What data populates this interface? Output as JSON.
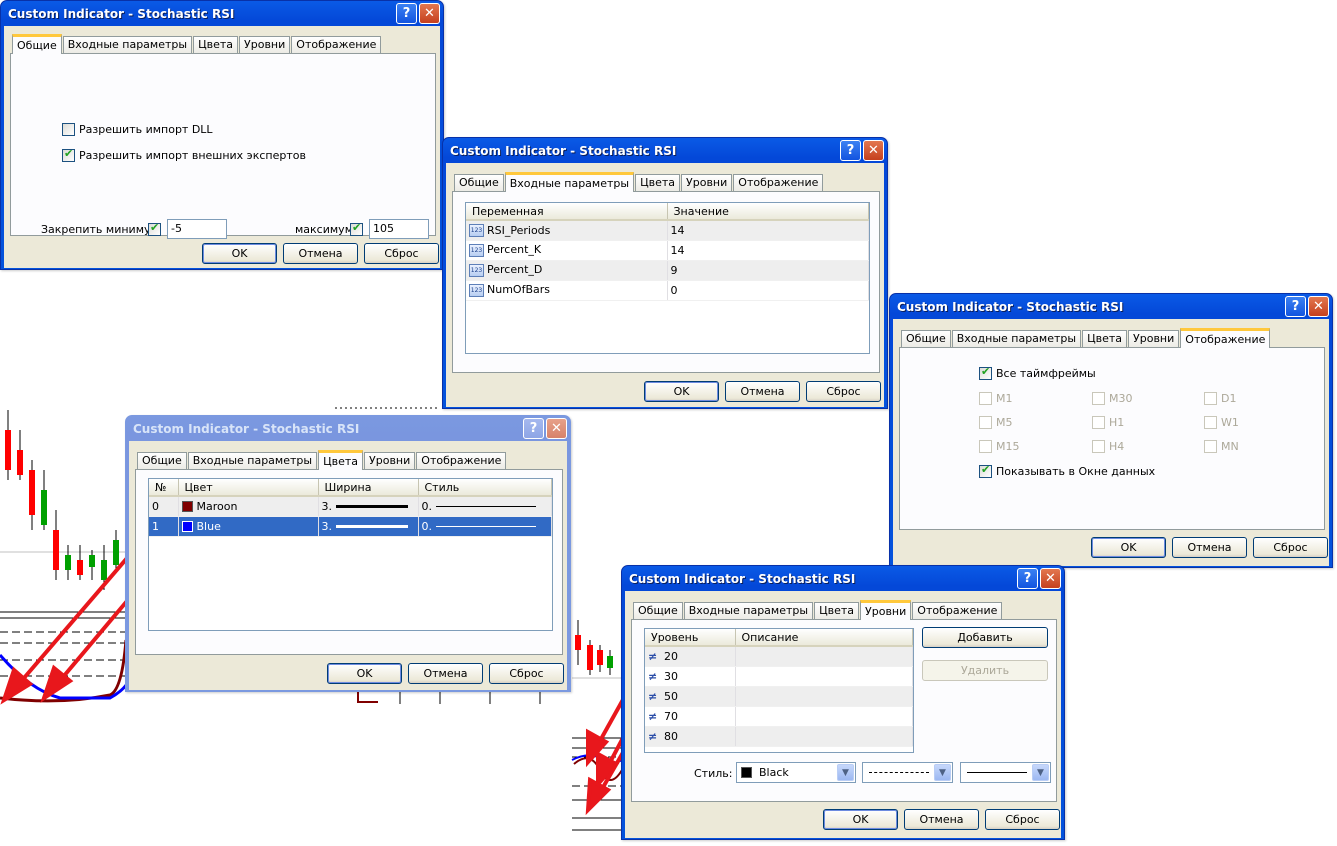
{
  "window_title": "Custom Indicator - Stochastic RSI",
  "titlebar_buttons": {
    "help": "?",
    "close": "✕"
  },
  "tabs": [
    "Общие",
    "Входные параметры",
    "Цвета",
    "Уровни",
    "Отображение"
  ],
  "buttons": {
    "ok": "OK",
    "cancel": "Отмена",
    "reset": "Сброс"
  },
  "general": {
    "allow_dll": {
      "label": "Разрешить импорт DLL",
      "checked": false
    },
    "allow_experts": {
      "label": "Разрешить импорт внешних экспертов",
      "checked": true
    },
    "fix_min_label": "Закрепить минимум",
    "fix_min_value": "-5",
    "fix_max_label": "максимум",
    "fix_max_value": "105"
  },
  "inputs": {
    "headers": [
      "Переменная",
      "Значение"
    ],
    "icon": "123",
    "rows": [
      {
        "name": "RSI_Periods",
        "value": "14"
      },
      {
        "name": "Percent_K",
        "value": "14"
      },
      {
        "name": "Percent_D",
        "value": "9"
      },
      {
        "name": "NumOfBars",
        "value": "0"
      }
    ]
  },
  "colors": {
    "headers": [
      "№",
      "Цвет",
      "Ширина",
      "Стиль"
    ],
    "rows": [
      {
        "index": "0",
        "color_name": "Maroon",
        "color": "#800000",
        "width": "3.",
        "style": "0."
      },
      {
        "index": "1",
        "color_name": "Blue",
        "color": "#0000ff",
        "width": "3.",
        "style": "0."
      }
    ]
  },
  "display": {
    "all_timeframes": "Все таймфреймы",
    "timeframes": [
      "M1",
      "M30",
      "D1",
      "M5",
      "H1",
      "W1",
      "M15",
      "H4",
      "MN"
    ],
    "show_in_data_window": "Показывать в Окне данных"
  },
  "levels": {
    "headers": [
      "Уровень",
      "Описание"
    ],
    "values": [
      "20",
      "30",
      "50",
      "70",
      "80"
    ],
    "add": "Добавить",
    "remove": "Удалить",
    "style_label": "Стиль:",
    "style_color": "Black",
    "style_color_hex": "#000000"
  }
}
